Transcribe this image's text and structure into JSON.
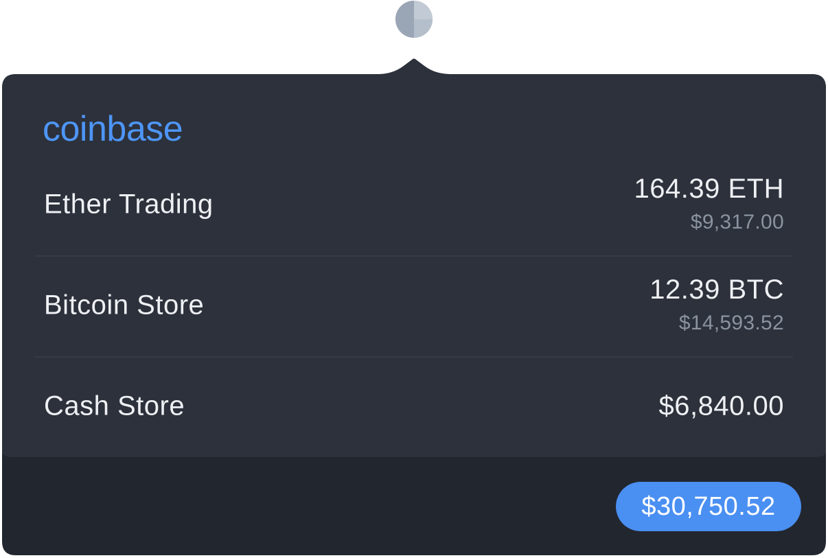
{
  "app": {
    "tray_icon": "half-circle-tray-icon",
    "brand": "coinbase"
  },
  "colors": {
    "panel": "#2c313b",
    "footer": "#22262e",
    "brand_blue": "#4e95f6",
    "pill_blue": "#4a8ff2",
    "primary_text": "#eef0f4",
    "secondary_text": "#8b93a0"
  },
  "accounts": [
    {
      "name": "Ether Trading",
      "amount": "164.39 ETH",
      "fiat": "$9,317.00"
    },
    {
      "name": "Bitcoin Store",
      "amount": "12.39 BTC",
      "fiat": "$14,593.52"
    },
    {
      "name": "Cash Store",
      "amount": "$6,840.00"
    }
  ],
  "total": "$30,750.52"
}
